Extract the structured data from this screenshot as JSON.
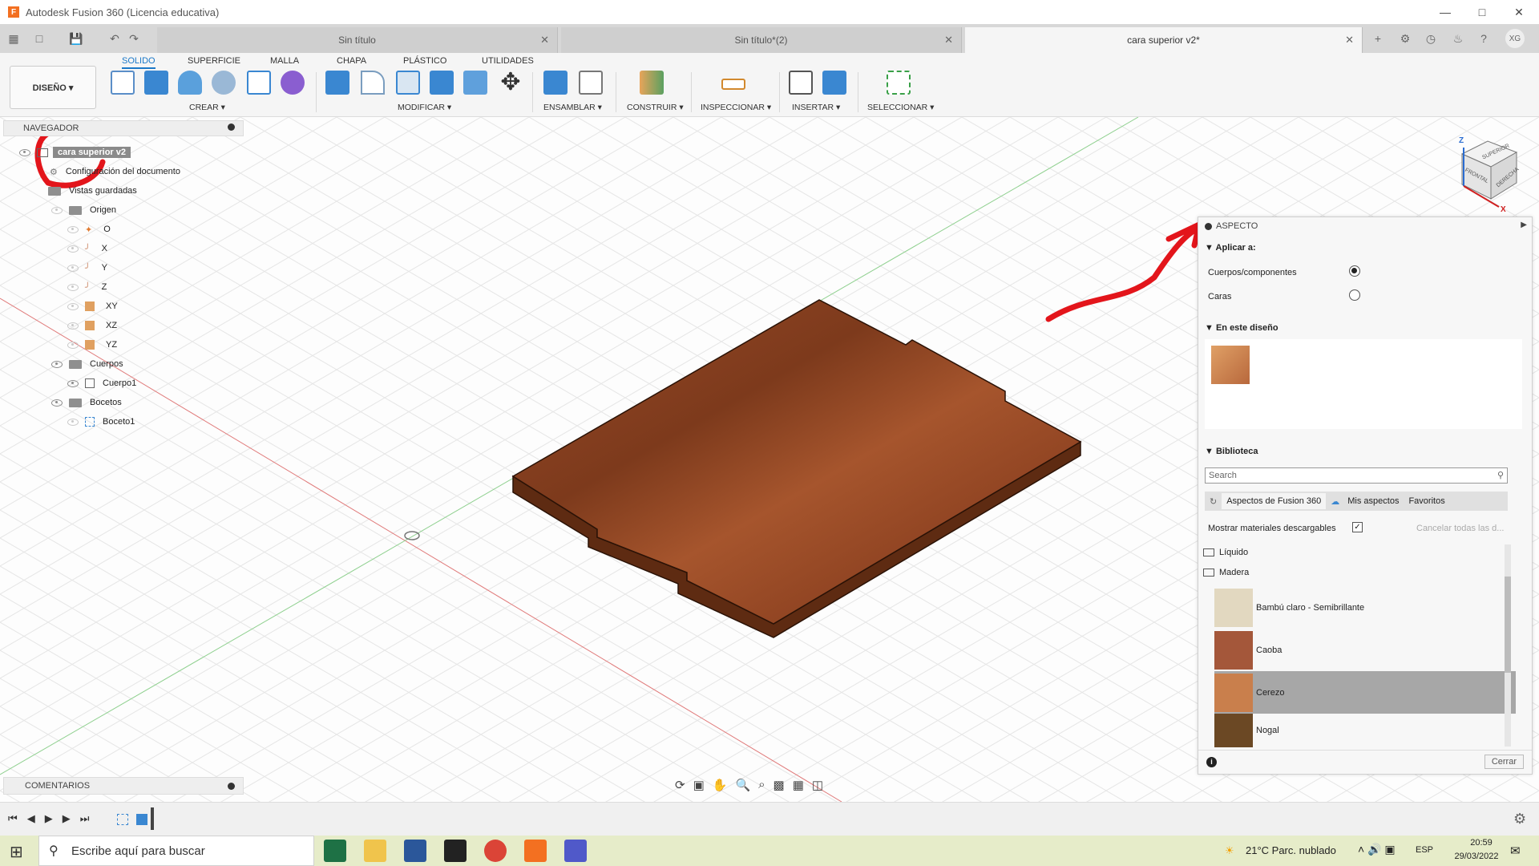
{
  "window": {
    "title": "Autodesk Fusion 360 (Licencia educativa)",
    "logo_letter": "F"
  },
  "tabs": [
    {
      "label": "Sin título"
    },
    {
      "label": "Sin título*(2)"
    },
    {
      "label": "cara superior v2*"
    }
  ],
  "user_initials": "XG",
  "ribbon": {
    "tabs": [
      "SOLIDO",
      "SUPERFICIE",
      "MALLA",
      "CHAPA",
      "PLÁSTICO",
      "UTILIDADES"
    ],
    "design_button": "DISEÑO ▾",
    "groups": [
      "CREAR ▾",
      "MODIFICAR ▾",
      "ENSAMBLAR ▾",
      "CONSTRUIR ▾",
      "INSPECCIONAR ▾",
      "INSERTAR ▾",
      "SELECCIONAR ▾"
    ]
  },
  "navigator": {
    "title": "NAVEGADOR",
    "root": "cara superior v2",
    "items": [
      {
        "label": "Configuración del documento"
      },
      {
        "label": "Vistas guardadas"
      },
      {
        "label": "Origen"
      },
      {
        "label": "O"
      },
      {
        "label": "X"
      },
      {
        "label": "Y"
      },
      {
        "label": "Z"
      },
      {
        "label": "XY"
      },
      {
        "label": "XZ"
      },
      {
        "label": "YZ"
      },
      {
        "label": "Cuerpos"
      },
      {
        "label": "Cuerpo1"
      },
      {
        "label": "Bocetos"
      },
      {
        "label": "Boceto1"
      }
    ]
  },
  "comments_label": "COMENTARIOS",
  "viewcube": {
    "top": "SUPERIOR",
    "front": "FRONTAL",
    "right": "DERECHA",
    "z": "Z",
    "x": "X"
  },
  "aspecto": {
    "title": "ASPECTO",
    "apply_section": "Aplicar a:",
    "apply_options": [
      {
        "label": "Cuerpos/componentes",
        "selected": true
      },
      {
        "label": "Caras",
        "selected": false
      }
    ],
    "in_design_section": "En este diseño",
    "library_section": "Biblioteca",
    "search_placeholder": "Search",
    "lib_tabs": [
      "Aspectos de Fusion 360",
      "Mis aspectos",
      "Favoritos"
    ],
    "show_downloadable": "Mostrar materiales descargables",
    "cancel_all": "Cancelar todas las d...",
    "folders": [
      "Líquido",
      "Madera"
    ],
    "materials": [
      {
        "label": "Bambú claro - Semibrillante",
        "color": "#e2d8c0"
      },
      {
        "label": "Caoba",
        "color": "#a4573a"
      },
      {
        "label": "Cerezo",
        "color": "#c97f4c"
      },
      {
        "label": "Nogal",
        "color": "#6b4824"
      }
    ],
    "close_button": "Cerrar"
  },
  "taskbar": {
    "search_placeholder": "Escribe aquí para buscar",
    "weather": "21°C  Parc. nublado",
    "lang": "ESP",
    "time": "20:59",
    "date": "29/03/2022"
  },
  "colors": {
    "accent": "#1b78c8",
    "wood": "#8a3f1f",
    "annotation": "#e3151b"
  }
}
